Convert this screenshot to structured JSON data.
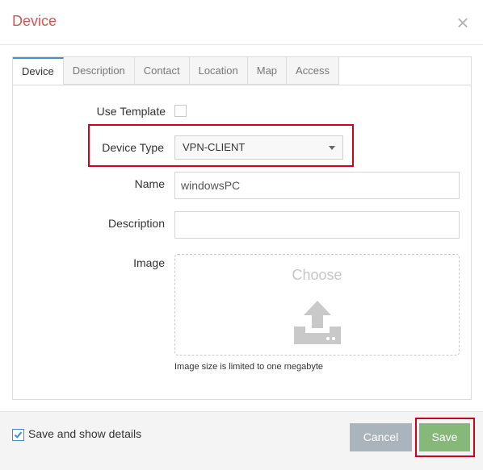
{
  "dialog": {
    "title": "Device",
    "close_symbol": "×"
  },
  "tabs": [
    {
      "label": "Device",
      "active": true
    },
    {
      "label": "Description",
      "active": false
    },
    {
      "label": "Contact",
      "active": false
    },
    {
      "label": "Location",
      "active": false
    },
    {
      "label": "Map",
      "active": false
    },
    {
      "label": "Access",
      "active": false
    }
  ],
  "form": {
    "use_template_label": "Use Template",
    "use_template_checked": false,
    "device_type_label": "Device Type",
    "device_type_value": "VPN-CLIENT",
    "name_label": "Name",
    "name_value": "windowsPC",
    "description_label": "Description",
    "description_value": "",
    "image_label": "Image",
    "image_choose": "Choose",
    "image_hint": "Image size is limited to one megabyte"
  },
  "footer": {
    "save_details_label": "Save and show details",
    "save_details_checked": true,
    "cancel_label": "Cancel",
    "save_label": "Save"
  },
  "colors": {
    "title": "#d9534f",
    "tab_active_border": "#4a90c6",
    "highlight": "#d0021b",
    "cancel_button": "#aab4bc",
    "save_button": "#86b87a"
  },
  "icons": {
    "close": "close-icon",
    "dropdown": "caret-down-icon",
    "upload": "upload-icon",
    "check": "checkmark-icon"
  }
}
